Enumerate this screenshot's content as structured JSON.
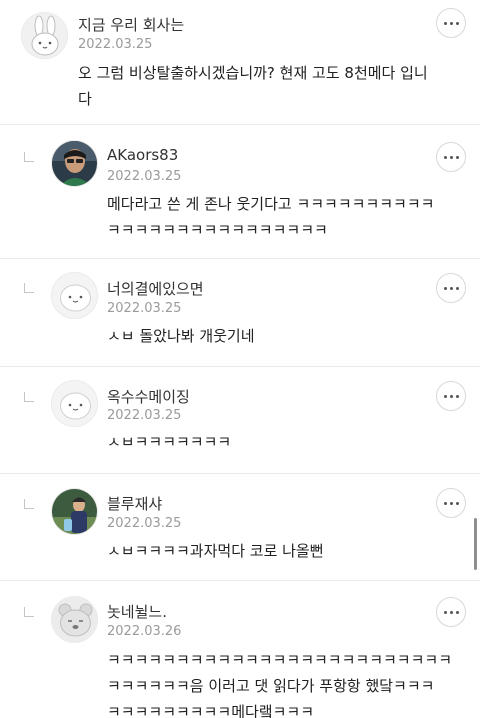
{
  "comments": [
    {
      "nickname": "지금 우리 회사는",
      "date": "2022.03.25",
      "lines": [
        "오 그럼 비상탈출하시겠습니까? 현재 고도 8천메다 입니",
        "다"
      ],
      "avatar_icon": "rabbit-icon",
      "is_reply": false
    },
    {
      "nickname": "AKaors83",
      "date": "2022.03.25",
      "lines": [
        "메다라고 쓴 게 존나 웃기다고 ㅋㅋㅋㅋㅋㅋㅋㅋㅋㅋ",
        "ㅋㅋㅋㅋㅋㅋㅋㅋㅋㅋㅋㅋㅋㅋㅋㅋ"
      ],
      "avatar_icon": "person-photo-icon",
      "is_reply": true
    },
    {
      "nickname": "너의결에있으면",
      "date": "2022.03.25",
      "lines": [
        "ㅅㅂ 돌았나봐 개웃기네"
      ],
      "avatar_icon": "default-face-icon",
      "is_reply": true
    },
    {
      "nickname": "옥수수메이징",
      "date": "2022.03.25",
      "lines": [
        "ㅅㅂㅋㅋㅋㅋㅋㅋㅋ"
      ],
      "avatar_icon": "default-face-icon",
      "is_reply": true
    },
    {
      "nickname": "블루재샤",
      "date": "2022.03.25",
      "lines": [
        "ㅅㅂㅋㅋㅋㅋ과자먹다 코로 나올뻔"
      ],
      "avatar_icon": "person-photo-icon",
      "is_reply": true
    },
    {
      "nickname": "놋네뉠느.",
      "date": "2022.03.26",
      "lines": [
        "ㅋㅋㅋㅋㅋㅋㅋㅋㅋㅋㅋㅋㅋㅋㅋㅋㅋㅋㅋㅋㅋㅋㅋㅋㅋ",
        "ㅋㅋㅋㅋㅋㅋ음 이러고 댓 읽다가 푸항항 했닼ㅋㅋㅋ",
        "ㅋㅋㅋㅋㅋㅋㅋㅋㅋ메다랰ㅋㅋㅋ"
      ],
      "avatar_icon": "bear-face-icon",
      "is_reply": true
    }
  ],
  "colors": {
    "text": "#222222",
    "muted": "#9a9a9a",
    "divider": "#e9e9e9",
    "border": "#d8d8d8"
  }
}
